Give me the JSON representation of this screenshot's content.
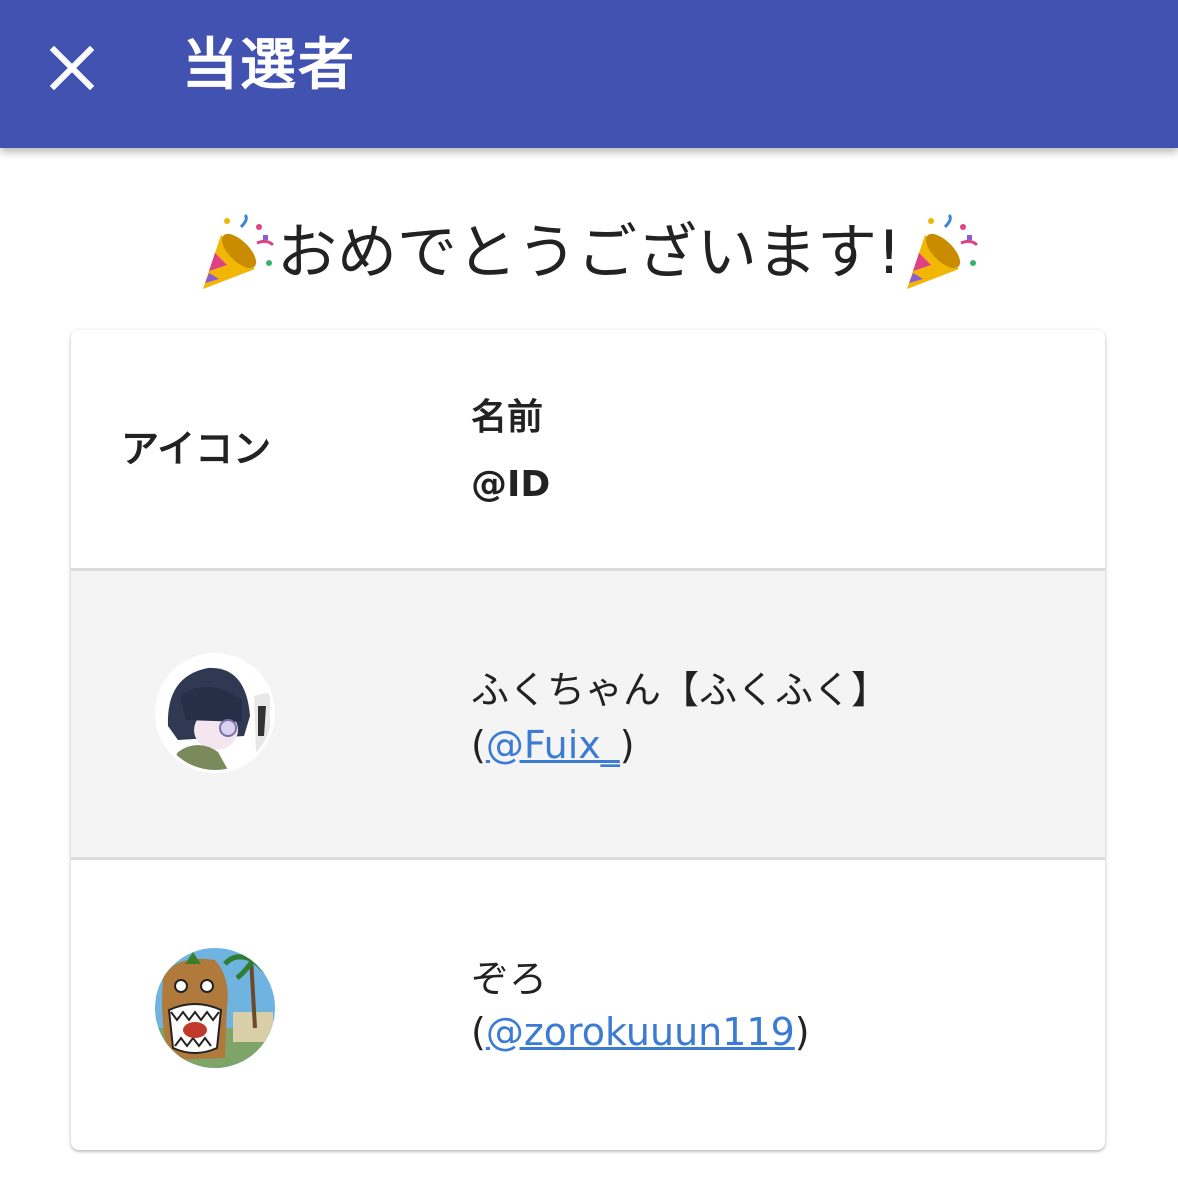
{
  "appbar": {
    "close_icon": "close-icon",
    "title": "当選者",
    "background": "#4152b1"
  },
  "congrats": {
    "text": "おめでとうございます!",
    "icon": "party-popper-icon"
  },
  "table": {
    "headers": {
      "icon": "アイコン",
      "name": "名前",
      "id": "@ID"
    },
    "rows": [
      {
        "name": "ふくちゃん【ふくふく】",
        "id_prefix": "(",
        "id": "@Fuix_",
        "id_suffix": ")",
        "avatar": "avatar-image"
      },
      {
        "name": "ぞろ",
        "id_prefix": "(",
        "id": "@zorokuuun119",
        "id_suffix": ")",
        "avatar": "avatar-image"
      }
    ]
  },
  "colors": {
    "accent": "#4152b1",
    "link": "#3b7bd4",
    "row_highlight": "#f4f4f4"
  }
}
